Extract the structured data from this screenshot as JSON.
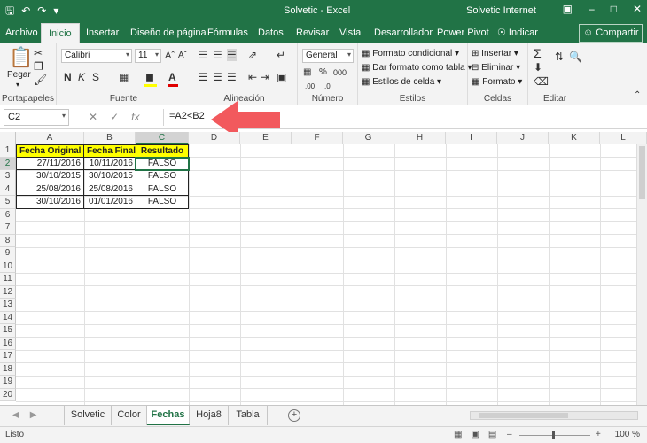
{
  "titlebar": {
    "qat": [
      "save-icon",
      "undo-icon",
      "redo-icon",
      "customize-icon"
    ],
    "title": "Solvetic  -  Excel",
    "account": "Solvetic Internet",
    "buttons": [
      "ribbon-display-icon",
      "minimize-icon",
      "maximize-icon",
      "close-icon"
    ]
  },
  "tabs": [
    "Archivo",
    "Inicio",
    "Insertar",
    "Diseño de página",
    "Fórmulas",
    "Datos",
    "Revisar",
    "Vista",
    "Desarrollador",
    "Power Pivot",
    "Indicar"
  ],
  "share_label": "Compartir",
  "ribbon": {
    "groups": [
      "Portapapeles",
      "Fuente",
      "Alineación",
      "Número",
      "Estilos",
      "Celdas",
      "Editar"
    ],
    "paste_label": "Pegar",
    "font_name": "Calibri",
    "font_size": "11",
    "number_format": "General",
    "styles": [
      "Formato condicional",
      "Dar formato como tabla",
      "Estilos de celda"
    ],
    "cells": [
      "Insertar",
      "Eliminar",
      "Formato"
    ]
  },
  "formula_bar": {
    "name_box": "C2",
    "formula": "=A2<B2",
    "fx": "fx"
  },
  "grid": {
    "columns": [
      "A",
      "B",
      "C",
      "D",
      "E",
      "F",
      "G",
      "H",
      "I",
      "J",
      "K",
      "L"
    ],
    "rows": [
      "1",
      "2",
      "3",
      "4",
      "5",
      "6",
      "7",
      "8",
      "9",
      "10",
      "11",
      "12",
      "13",
      "14",
      "15",
      "16",
      "17",
      "18",
      "19",
      "20"
    ],
    "headers": [
      "Fecha Original",
      "Fecha Final",
      "Resultado"
    ],
    "data": [
      [
        "27/11/2016",
        "10/11/2016",
        "FALSO"
      ],
      [
        "30/10/2015",
        "30/10/2015",
        "FALSO"
      ],
      [
        "25/08/2016",
        "25/08/2016",
        "FALSO"
      ],
      [
        "30/10/2016",
        "01/01/2016",
        "FALSO"
      ]
    ]
  },
  "sheets": [
    "Solvetic",
    "Color",
    "Fechas",
    "Hoja8",
    "Tabla"
  ],
  "active_sheet": "Fechas",
  "status": "Listo",
  "zoom": "100 %"
}
